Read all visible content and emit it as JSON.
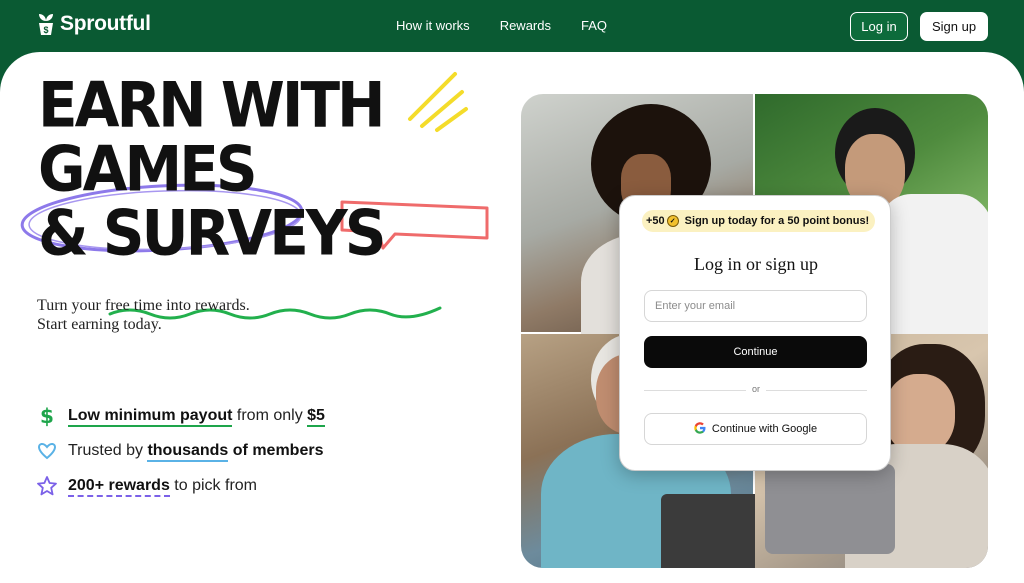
{
  "brand": {
    "name": "Sproutful"
  },
  "nav": {
    "links": [
      "How it works",
      "Rewards",
      "FAQ"
    ],
    "login_label": "Log in",
    "signup_label": "Sign up"
  },
  "hero": {
    "headline": [
      "EARN WITH",
      "GAMES",
      "& SURVEYS"
    ],
    "subtext": [
      "Turn your free time into rewards.",
      "Start earning today."
    ],
    "features": [
      {
        "icon": "dollar-icon",
        "parts": [
          "Low minimum payout",
          " from only ",
          "$5"
        ]
      },
      {
        "icon": "heart-icon",
        "parts": [
          "Trusted by ",
          "thousands",
          " of members"
        ]
      },
      {
        "icon": "star-icon",
        "parts": [
          "200+ rewards",
          " to pick from"
        ]
      }
    ]
  },
  "login_card": {
    "bonus_badge": "+50",
    "bonus_text": "Sign up today for a 50 point bonus!",
    "title": "Log in or sign up",
    "email_placeholder": "Enter your email",
    "continue_label": "Continue",
    "divider_text": "or",
    "google_label": "Continue with Google"
  },
  "colors": {
    "brand_green": "#0a5a33",
    "accent_green": "#1ea54b",
    "accent_blue": "#5ab2e6",
    "accent_purple": "#7b61e8",
    "accent_red": "#ef6b6b",
    "accent_yellow": "#f4dc2a"
  }
}
